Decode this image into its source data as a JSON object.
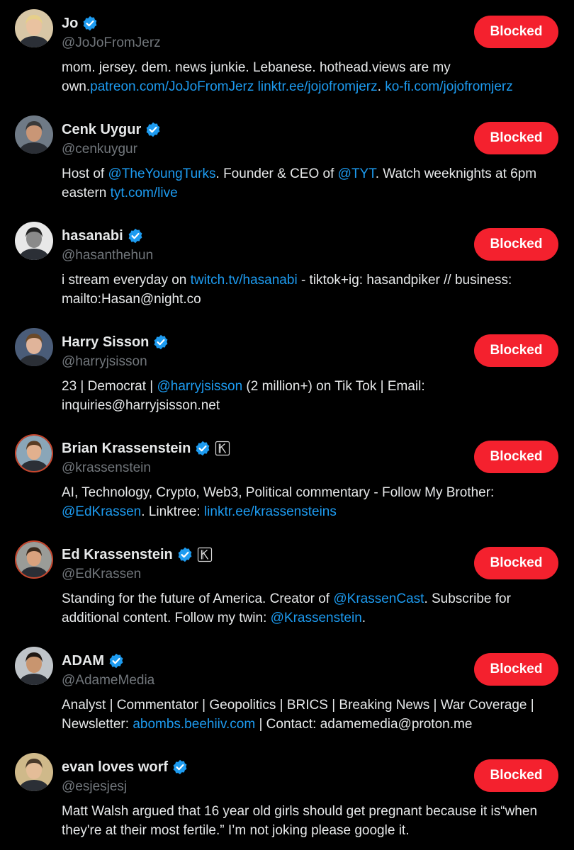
{
  "colors": {
    "background": "#000000",
    "text": "#e7e9ea",
    "muted": "#71767b",
    "link": "#1d9bf0",
    "blocked": "#f4212e",
    "verified": "#1d9bf0"
  },
  "users": [
    {
      "name": "Jo",
      "handle": "@JoJoFromJerz",
      "verified": true,
      "affiliate": false,
      "button": "Blocked",
      "bio_parts": [
        {
          "text": "mom. jersey. dem. news junkie. Lebanese. hothead.views are my own.",
          "link": false
        },
        {
          "text": "patreon.com/JoJoFromJerz",
          "link": true
        },
        {
          "text": " ",
          "link": false
        },
        {
          "text": "linktr.ee/jojofromjerz",
          "link": true
        },
        {
          "text": ". ",
          "link": false
        },
        {
          "text": "ko-fi.com/jojofromjerz",
          "link": true
        }
      ]
    },
    {
      "name": "Cenk Uygur",
      "handle": "@cenkuygur",
      "verified": true,
      "affiliate": false,
      "button": "Blocked",
      "bio_parts": [
        {
          "text": "Host of ",
          "link": false
        },
        {
          "text": "@TheYoungTurks",
          "link": true
        },
        {
          "text": ". Founder & CEO of ",
          "link": false
        },
        {
          "text": "@TYT",
          "link": true
        },
        {
          "text": ". Watch weeknights at 6pm eastern ",
          "link": false
        },
        {
          "text": "tyt.com/live",
          "link": true
        }
      ]
    },
    {
      "name": "hasanabi",
      "handle": "@hasanthehun",
      "verified": true,
      "affiliate": false,
      "button": "Blocked",
      "bio_parts": [
        {
          "text": "i stream everyday on ",
          "link": false
        },
        {
          "text": "twitch.tv/hasanabi",
          "link": true
        },
        {
          "text": " - tiktok+ig: hasandpiker // business: mailto:Hasan@night.co",
          "link": false
        }
      ]
    },
    {
      "name": "Harry Sisson",
      "handle": "@harryjsisson",
      "verified": true,
      "affiliate": false,
      "button": "Blocked",
      "bio_parts": [
        {
          "text": "23 | Democrat | ",
          "link": false
        },
        {
          "text": "@harryjsisson",
          "link": true
        },
        {
          "text": " (2 million+) on Tik Tok | Email: inquiries@harryjsisson.net",
          "link": false
        }
      ]
    },
    {
      "name": "Brian Krassenstein",
      "handle": "@krassenstein",
      "verified": true,
      "affiliate": true,
      "button": "Blocked",
      "bio_parts": [
        {
          "text": "AI, Technology, Crypto, Web3, Political commentary - Follow My Brother: ",
          "link": false
        },
        {
          "text": "@EdKrassen",
          "link": true
        },
        {
          "text": ". Linktree: ",
          "link": false
        },
        {
          "text": "linktr.ee/krassensteins",
          "link": true
        }
      ]
    },
    {
      "name": "Ed Krassenstein",
      "handle": "@EdKrassen",
      "verified": true,
      "affiliate": true,
      "button": "Blocked",
      "bio_parts": [
        {
          "text": "Standing for the future of America. Creator of ",
          "link": false
        },
        {
          "text": "@KrassenCast",
          "link": true
        },
        {
          "text": ". Subscribe for additional content. Follow my twin: ",
          "link": false
        },
        {
          "text": "@Krassenstein",
          "link": true
        },
        {
          "text": ".",
          "link": false
        }
      ]
    },
    {
      "name": "ADAM",
      "handle": "@AdameMedia",
      "verified": true,
      "affiliate": false,
      "button": "Blocked",
      "bio_parts": [
        {
          "text": "Analyst | Commentator | Geopolitics | BRICS | Breaking News | War Coverage | Newsletter: ",
          "link": false
        },
        {
          "text": "abombs.beehiiv.com",
          "link": true
        },
        {
          "text": " | Contact: adamemedia@proton.me",
          "link": false
        }
      ]
    },
    {
      "name": "evan loves worf",
      "handle": "@esjesjesj",
      "verified": true,
      "affiliate": false,
      "button": "Blocked",
      "bio_parts": [
        {
          "text": "Matt Walsh argued that 16 year old girls should get pregnant because it is“when they're at their most fertile.” I’m not joking please google it.",
          "link": false
        }
      ]
    }
  ]
}
